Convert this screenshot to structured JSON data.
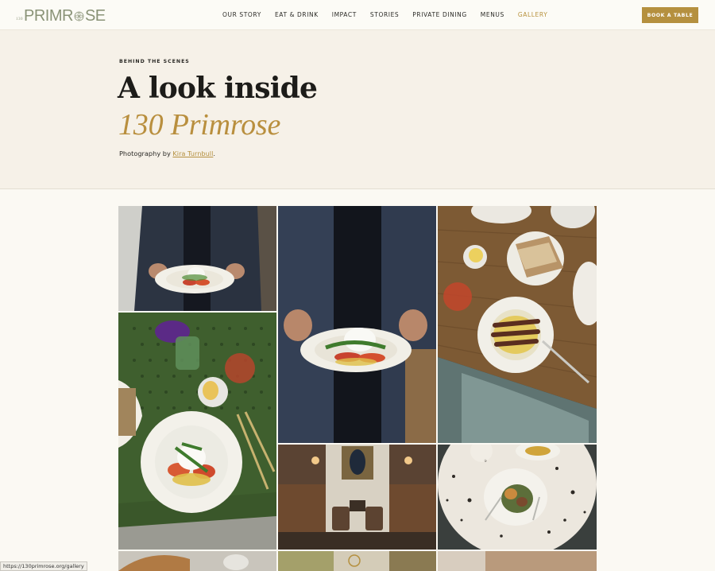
{
  "header": {
    "logo": {
      "prefix": "130",
      "wordmark_left": "PRIMR",
      "wordmark_right": "SE"
    },
    "nav": [
      {
        "label": "OUR STORY",
        "active": false
      },
      {
        "label": "EAT & DRINK",
        "active": false
      },
      {
        "label": "IMPACT",
        "active": false
      },
      {
        "label": "STORIES",
        "active": false
      },
      {
        "label": "PRIVATE DINING",
        "active": false
      },
      {
        "label": "MENUS",
        "active": false
      },
      {
        "label": "GALLERY",
        "active": true
      }
    ],
    "book_button": "BOOK A TABLE"
  },
  "hero": {
    "eyebrow": "BEHIND THE SCENES",
    "headline": "A look inside",
    "headline_accent": "130 Primrose",
    "credit_prefix": "Photography by ",
    "credit_name": "Kira Turnbull",
    "credit_suffix": "."
  },
  "gallery": {
    "images": [
      {
        "subject": "server-holding-burrata-plate"
      },
      {
        "subject": "server-holding-burrata-plate-closeup"
      },
      {
        "subject": "table-overhead-bread-and-dish"
      },
      {
        "subject": "green-table-burrata-overhead"
      },
      {
        "subject": "dining-room-interior"
      },
      {
        "subject": "terrazzo-table-dish"
      },
      {
        "subject": "bread-basket-partial"
      },
      {
        "subject": "window-view-partial"
      },
      {
        "subject": "interior-partial"
      }
    ]
  },
  "status_bar": {
    "url": "https://130primrose.org/gallery"
  },
  "colors": {
    "accent": "#b5903f",
    "logo": "#8a9377",
    "hero_bg": "#f6f1e8",
    "page_bg": "#fbf9f3"
  }
}
